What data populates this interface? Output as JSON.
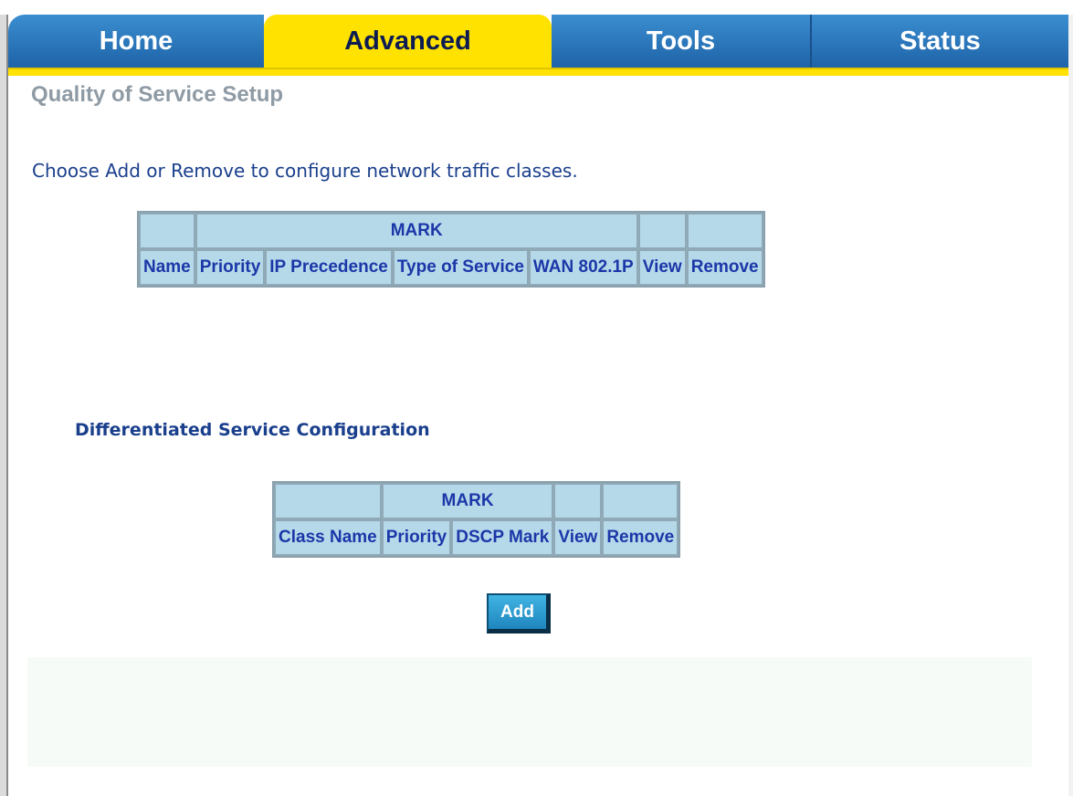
{
  "tabs": [
    {
      "label": "Home"
    },
    {
      "label": "Advanced"
    },
    {
      "label": "Tools"
    },
    {
      "label": "Status"
    }
  ],
  "active_tab": "Advanced",
  "page_title": "Quality of Service Setup",
  "intro_text": "Choose Add or Remove to configure network traffic classes.",
  "qos_table": {
    "group_header": "MARK",
    "columns": [
      "Name",
      "Priority",
      "IP Precedence",
      "Type of Service",
      "WAN 802.1P",
      "View",
      "Remove"
    ]
  },
  "ds_section": {
    "heading": "Differentiated Service Configuration",
    "group_header": "MARK",
    "columns": [
      "Class Name",
      "Priority",
      "DSCP Mark",
      "View",
      "Remove"
    ]
  },
  "add_button": "Add",
  "colors": {
    "tab_blue": "#2a76bd",
    "tab_active": "#ffe200",
    "table_bg": "#b6d9ea",
    "header_text": "#1b37a8"
  }
}
